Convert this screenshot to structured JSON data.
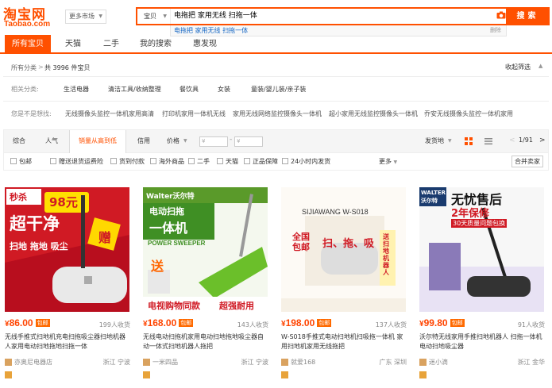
{
  "logo": {
    "cn": "淘宝网",
    "en": "Taobao.com"
  },
  "market_label": "更多市场",
  "search": {
    "category": "宝贝",
    "query": "电拖把 家用无线 扫拖一体",
    "button": "搜索"
  },
  "suggest": {
    "text": "电拖把 家用无线 扫拖一体",
    "delete": "删除"
  },
  "tabs": [
    "所有宝贝",
    "天猫",
    "二手",
    "我的搜索",
    "惠发现"
  ],
  "breadcrumb": {
    "all": "所有分类",
    "count": "共 3996 件宝贝",
    "collapse": "收起筛选"
  },
  "related": {
    "label": "相关分类:",
    "items": [
      "生活电器",
      "清洁工具/收纳整理",
      "餐饮具",
      "女装",
      "童装/婴儿装/亲子装"
    ]
  },
  "want": {
    "label": "您是不是想找:",
    "items": [
      "无线摄像头监控一体机家用高清",
      "打印机家用一体机无线",
      "家用无线网络监控摄像头一体机",
      "超小家用无线监控摄像头一体机",
      "乔安无线摄像头监控一体机家用"
    ]
  },
  "sort": {
    "items": [
      "综合",
      "人气",
      "销量从高到低",
      "信用",
      "价格"
    ],
    "price_min": "¥",
    "price_max": "¥",
    "ship_from": "发货地",
    "page": "1/91"
  },
  "options": {
    "items": [
      "包邮",
      "赠送退货运费险",
      "货到付款",
      "海外商品",
      "二手",
      "天猫",
      "正品保障",
      "24小时内发货"
    ],
    "more": "更多",
    "merge": "合并卖家"
  },
  "products": [
    {
      "price": "86.00",
      "badge": "包邮",
      "sales": "199人收货",
      "title": "无线手推式扫地机充电扫拖吸尘器扫地机器人家用电动扫地拖地扫拖一体",
      "shop": "亦奥尼电器店",
      "loc": "浙江 宁波",
      "img_text": [
        "秒杀",
        "98元",
        "超干净",
        "扫地 拖地 吸尘",
        "赠"
      ]
    },
    {
      "price": "168.00",
      "badge": "包邮",
      "sales": "143人收货",
      "title": "无线电动扫拖机家用电动扫地拖地吸尘器自动一体式扫地机器人拖把",
      "shop": "一米四品",
      "loc": "浙江 宁波",
      "img_text": [
        "Walter沃尔特",
        "电动扫拖",
        "一体机",
        "POWER SWEEPER",
        "送",
        "电视购物同款",
        "超强耐用"
      ]
    },
    {
      "price": "198.00",
      "badge": "包邮",
      "sales": "137人收货",
      "title": "W-S018手推式电动扫地机扫吸拖一体机 家用扫地机家用无线拖把",
      "shop": "就爱168",
      "loc": "广东 深圳",
      "img_text": [
        "SIJIAWANG W-S018",
        "全国包邮",
        "扫、拖、吸",
        "送扫地机器人"
      ]
    },
    {
      "price": "99.80",
      "badge": "包邮",
      "sales": "91人收货",
      "title": "沃尔特无线家用手推扫地机器人 扫拖一体机电动扫地吸尘器",
      "shop": "迷小滴",
      "loc": "浙江 金华",
      "img_text": [
        "WALTER 沃尔特",
        "无忧售后",
        "2年保修",
        "30天质量问题包换"
      ]
    }
  ],
  "colors": {
    "brand": "#ff5000",
    "price": "#ff4400",
    "link": "#1566c3"
  }
}
